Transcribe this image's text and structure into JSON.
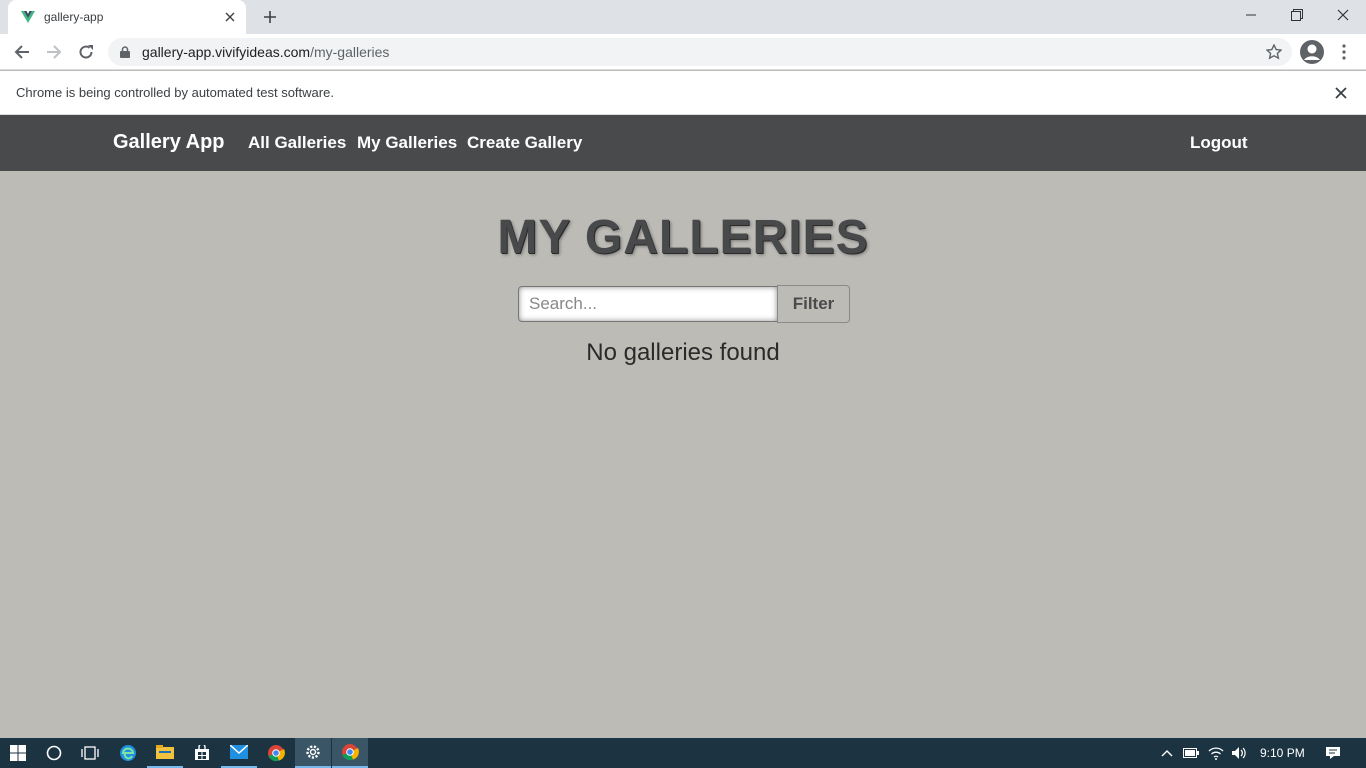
{
  "browser": {
    "tab_title": "gallery-app",
    "url_host": "gallery-app.vivifyideas.com",
    "url_path": "/my-galleries",
    "infobar_text": "Chrome is being controlled by automated test software."
  },
  "navbar": {
    "brand": "Gallery App",
    "links": [
      "All Galleries",
      "My Galleries",
      "Create Gallery"
    ],
    "logout": "Logout"
  },
  "main": {
    "title": "MY GALLERIES",
    "search_placeholder": "Search...",
    "filter_label": "Filter",
    "empty_message": "No galleries found"
  },
  "taskbar": {
    "clock": "9:10 PM",
    "apps": [
      "start-icon",
      "cortana-icon",
      "task-view-icon",
      "edge-icon",
      "file-explorer-icon",
      "store-icon",
      "mail-icon",
      "chrome-icon",
      "settings-icon",
      "chrome-icon"
    ]
  },
  "colors": {
    "page_bg": "#bdbbb6",
    "navbar_bg": "#494a4c",
    "taskbar_bg": "#1c3341"
  }
}
